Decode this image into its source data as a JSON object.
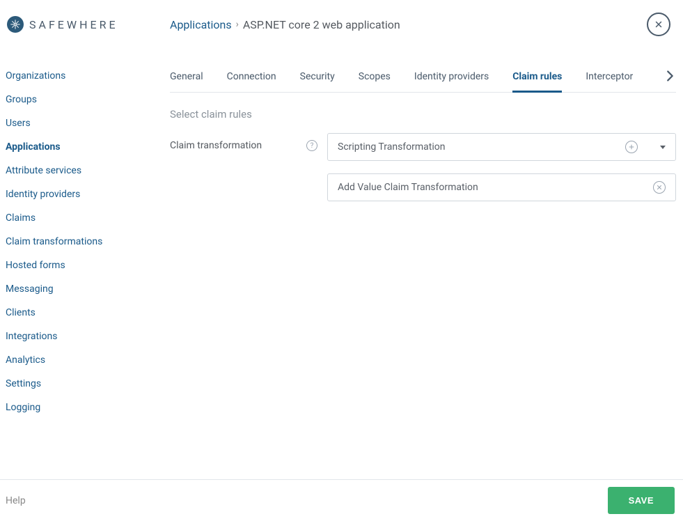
{
  "brand": "SAFEWHERE",
  "breadcrumb": {
    "parent": "Applications",
    "separator": "›",
    "current": "ASP.NET core 2 web application"
  },
  "sidebar": {
    "items": [
      {
        "label": "Organizations",
        "active": false
      },
      {
        "label": "Groups",
        "active": false
      },
      {
        "label": "Users",
        "active": false
      },
      {
        "label": "Applications",
        "active": true
      },
      {
        "label": "Attribute services",
        "active": false
      },
      {
        "label": "Identity providers",
        "active": false
      },
      {
        "label": "Claims",
        "active": false
      },
      {
        "label": "Claim transformations",
        "active": false
      },
      {
        "label": "Hosted forms",
        "active": false
      },
      {
        "label": "Messaging",
        "active": false
      },
      {
        "label": "Clients",
        "active": false
      },
      {
        "label": "Integrations",
        "active": false
      },
      {
        "label": "Analytics",
        "active": false
      },
      {
        "label": "Settings",
        "active": false
      },
      {
        "label": "Logging",
        "active": false
      }
    ]
  },
  "tabs": [
    {
      "label": "General",
      "active": false
    },
    {
      "label": "Connection",
      "active": false
    },
    {
      "label": "Security",
      "active": false
    },
    {
      "label": "Scopes",
      "active": false
    },
    {
      "label": "Identity providers",
      "active": false
    },
    {
      "label": "Claim rules",
      "active": true
    },
    {
      "label": "Interceptor",
      "active": false
    }
  ],
  "section": {
    "title": "Select claim rules",
    "field_label": "Claim transformation"
  },
  "transforms": {
    "selector_value": "Scripting Transformation",
    "added_value": "Add Value Claim Transformation"
  },
  "footer": {
    "help": "Help",
    "save": "SAVE"
  }
}
